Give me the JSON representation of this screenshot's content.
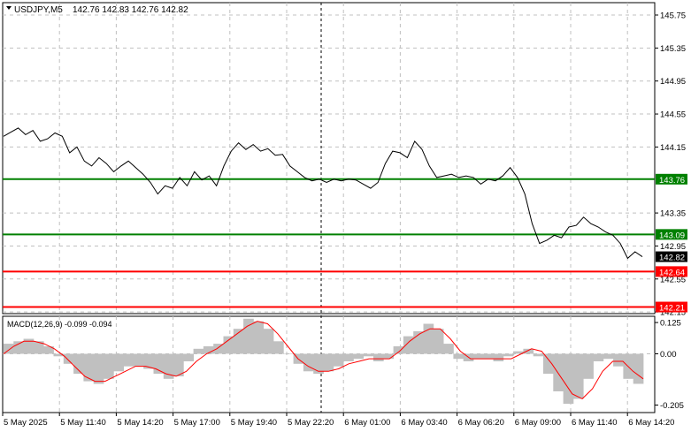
{
  "symbol_header": {
    "symbol": "USDJPY,M5",
    "ohlc": "142.76 142.83 142.76 142.82"
  },
  "macd_header": "MACD(12,26,9) -0.099 -0.094",
  "colors": {
    "price_line": "#000000",
    "grid": "#c0c0c0",
    "support_green": "#008000",
    "resistance_red": "#ff0000",
    "macd_hist": "#c0c0c0",
    "macd_signal": "#ff0000",
    "current_price_tag": "#000000"
  },
  "chart_data": [
    {
      "type": "line",
      "name": "price",
      "ylim": [
        142.13,
        145.9
      ],
      "y_ticks": [
        "145.75",
        "145.35",
        "144.95",
        "144.55",
        "144.15",
        "143.35",
        "142.95",
        "142.55",
        "142.15"
      ],
      "x_ticks": [
        "5 May 2025",
        "5 May 11:40",
        "5 May 14:20",
        "5 May 17:00",
        "5 May 19:40",
        "5 May 22:20",
        "6 May 01:00",
        "6 May 03:40",
        "6 May 06:20",
        "6 May 09:00",
        "6 May 11:40",
        "6 May 14:20"
      ],
      "values": [
        144.28,
        144.33,
        144.38,
        144.3,
        144.35,
        144.22,
        144.25,
        144.32,
        144.28,
        144.08,
        144.15,
        143.98,
        143.92,
        144.02,
        143.95,
        143.85,
        143.92,
        143.98,
        143.9,
        143.82,
        143.72,
        143.58,
        143.68,
        143.65,
        143.78,
        143.68,
        143.85,
        143.75,
        143.8,
        143.68,
        143.92,
        144.1,
        144.2,
        144.12,
        144.18,
        144.1,
        144.13,
        144.05,
        144.06,
        143.92,
        143.85,
        143.78,
        143.74,
        143.76,
        143.72,
        143.76,
        143.74,
        143.76,
        143.75,
        143.7,
        143.65,
        143.72,
        143.95,
        144.1,
        144.08,
        144.02,
        144.22,
        144.12,
        143.92,
        143.78,
        143.8,
        143.82,
        143.78,
        143.8,
        143.78,
        143.7,
        143.76,
        143.74,
        143.8,
        143.9,
        143.78,
        143.58,
        143.22,
        142.98,
        143.02,
        143.08,
        143.05,
        143.18,
        143.2,
        143.3,
        143.22,
        143.18,
        143.12,
        143.08,
        142.98,
        142.8,
        142.88,
        142.82
      ],
      "levels": [
        {
          "label": "143.76",
          "value": 143.76,
          "color": "#008000"
        },
        {
          "label": "143.09",
          "value": 143.09,
          "color": "#008000"
        },
        {
          "label": "142.64",
          "value": 142.64,
          "color": "#ff0000"
        },
        {
          "label": "142.21",
          "value": 142.21,
          "color": "#ff0000"
        }
      ],
      "current_price": {
        "label": "142.82",
        "value": 142.82
      },
      "grid": true
    },
    {
      "type": "bar",
      "name": "MACD",
      "ylim": [
        -0.235,
        0.15
      ],
      "y_ticks": [
        "0.125",
        "0.00",
        "-0.205"
      ],
      "histogram": [
        0.04,
        0.05,
        0.06,
        0.05,
        0.03,
        -0.01,
        -0.04,
        -0.08,
        -0.11,
        -0.12,
        -0.1,
        -0.07,
        -0.05,
        -0.05,
        -0.06,
        -0.08,
        -0.1,
        -0.09,
        -0.03,
        0.02,
        0.03,
        0.04,
        0.07,
        0.1,
        0.14,
        0.13,
        0.1,
        0.05,
        0.0,
        -0.04,
        -0.07,
        -0.08,
        -0.07,
        -0.05,
        -0.03,
        -0.02,
        -0.01,
        -0.03,
        -0.02,
        0.03,
        0.07,
        0.09,
        0.12,
        0.1,
        0.04,
        -0.02,
        -0.03,
        -0.02,
        -0.02,
        -0.03,
        -0.01,
        0.01,
        0.02,
        -0.01,
        -0.08,
        -0.15,
        -0.2,
        -0.18,
        -0.1,
        -0.03,
        -0.02,
        -0.05,
        -0.1,
        -0.12
      ],
      "signal": [
        0.0,
        0.03,
        0.05,
        0.05,
        0.04,
        0.02,
        -0.01,
        -0.05,
        -0.09,
        -0.11,
        -0.11,
        -0.09,
        -0.07,
        -0.05,
        -0.05,
        -0.06,
        -0.08,
        -0.09,
        -0.07,
        -0.03,
        0.0,
        0.02,
        0.05,
        0.08,
        0.11,
        0.13,
        0.12,
        0.08,
        0.03,
        -0.02,
        -0.05,
        -0.07,
        -0.07,
        -0.06,
        -0.04,
        -0.03,
        -0.02,
        -0.02,
        -0.02,
        0.01,
        0.05,
        0.08,
        0.1,
        0.1,
        0.06,
        0.01,
        -0.02,
        -0.02,
        -0.02,
        -0.02,
        -0.02,
        0.0,
        0.02,
        0.01,
        -0.04,
        -0.1,
        -0.16,
        -0.18,
        -0.14,
        -0.07,
        -0.03,
        -0.03,
        -0.07,
        -0.1
      ]
    }
  ]
}
